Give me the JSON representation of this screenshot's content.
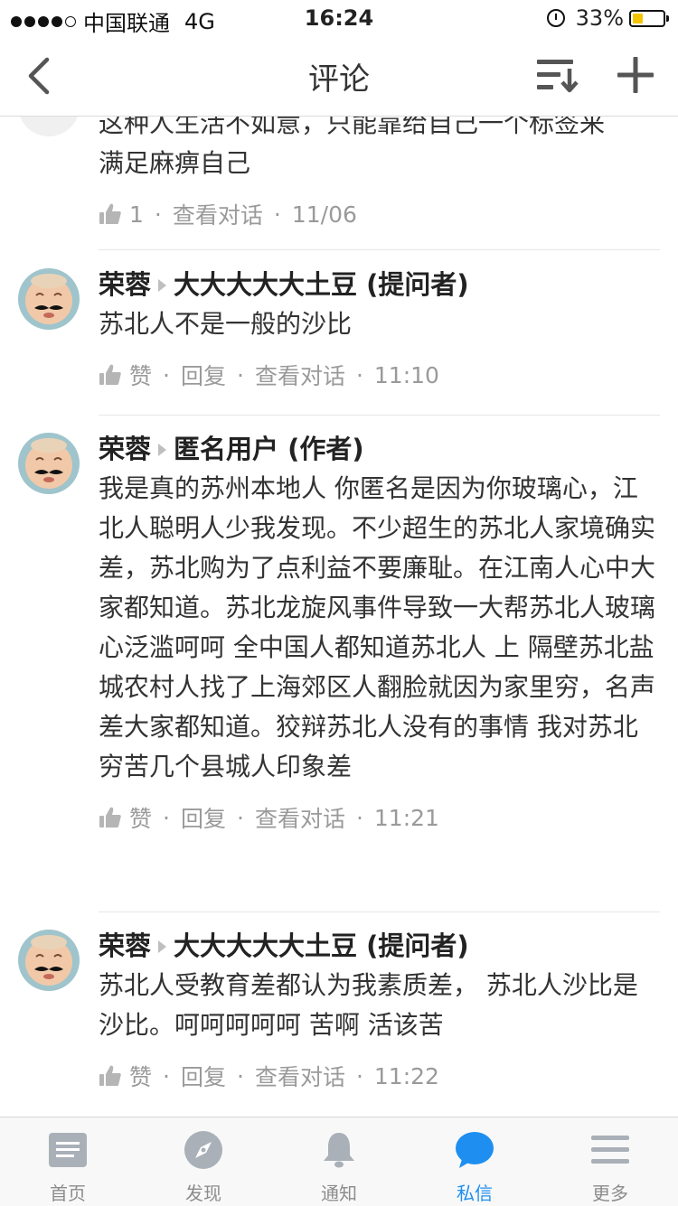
{
  "status_bar": {
    "carrier": "中国联通",
    "network": "4G",
    "time": "16:24",
    "battery": "33%",
    "battery_level": 0.33
  },
  "nav": {
    "title": "评论"
  },
  "comments": [
    {
      "text_line1": "这种人生活不如意，只能靠给自己一个标签来",
      "text_line2": "满足麻痹自己",
      "likes": "1",
      "view_conversation": "查看对话",
      "time": "11/06"
    },
    {
      "author": "荣蓉",
      "reply_to": "大大大大大土豆 (提问者)",
      "text": "苏北人不是一般的沙比",
      "like_label": "赞",
      "reply_label": "回复",
      "view_conversation": "查看对话",
      "time": "11:10"
    },
    {
      "author": "荣蓉",
      "reply_to": "匿名用户 (作者)",
      "text": "我是真的苏州本地人 你匿名是因为你玻璃心，江北人聪明人少我发现。不少超生的苏北人家境确实差，苏北购为了点利益不要廉耻。在江南人心中大家都知道。苏北龙旋风事件导致一大帮苏北人玻璃心泛滥呵呵 全中国人都知道苏北人 上  隔壁苏北盐城农村人找了上海郊区人翻脸就因为家里穷，名声差大家都知道。狡辩苏北人没有的事情 我对苏北穷苦几个县城人印象差",
      "like_label": "赞",
      "reply_label": "回复",
      "view_conversation": "查看对话",
      "time": "11:21"
    },
    {
      "author": "荣蓉",
      "reply_to": "大大大大大土豆 (提问者)",
      "text": "苏北人受教育差都认为我素质差， 苏北人沙比是沙比。呵呵呵呵呵 苦啊 活该苦",
      "like_label": "赞",
      "reply_label": "回复",
      "view_conversation": "查看对话",
      "time": "11:22"
    }
  ],
  "tabs": [
    {
      "label": "首页",
      "icon": "home-icon"
    },
    {
      "label": "发现",
      "icon": "compass-icon"
    },
    {
      "label": "通知",
      "icon": "bell-icon"
    },
    {
      "label": "私信",
      "icon": "chat-bubble-icon"
    },
    {
      "label": "更多",
      "icon": "menu-icon"
    }
  ],
  "colors": {
    "accent": "#1e8ff0",
    "meta": "#9a9a9a",
    "battery": "#f5c400"
  }
}
